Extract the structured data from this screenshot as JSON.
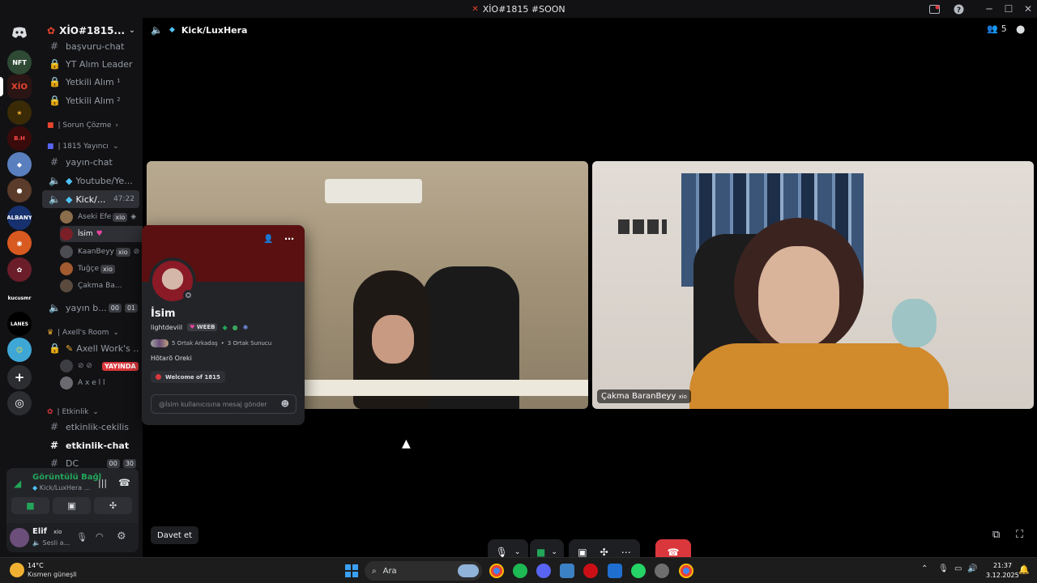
{
  "window": {
    "title": "XİO#1815 #SOON"
  },
  "server": {
    "name": "XİO#1815..."
  },
  "channels": {
    "items": [
      {
        "label": "başvuru-chat",
        "icon": "hash-icon"
      },
      {
        "label": "YT Alım Leader",
        "icon": "lock-icon"
      },
      {
        "label": "Yetkili Alım ¹",
        "icon": "lock-icon"
      },
      {
        "label": "Yetkili Alım ²",
        "icon": "lock-icon"
      }
    ],
    "cat_sorun": "| Sorun Çözme",
    "cat_yayinci": "| 1815 Yayıncı",
    "yayin_chat": "yayın-chat",
    "youtube": "Youtube/Ye...",
    "kick": "Kick/...",
    "kick_time": "47:22",
    "voice_users": [
      {
        "name": "Aseki Efe",
        "tag": "xio"
      },
      {
        "name": "İsim",
        "tag": ""
      },
      {
        "name": "KaanBeyy",
        "tag": "xio"
      },
      {
        "name": "Tuğçe",
        "tag": "xio"
      },
      {
        "name": "Çakma Ba...",
        "tag": ""
      }
    ],
    "yayin_b": "yayın b...",
    "yayin_b_counts": [
      "00",
      "01"
    ],
    "cat_axell": "| Axell's Room",
    "axell_work": "Axell Work's ...",
    "live_badge": "YAYINDA",
    "axell_user": "A x e l l",
    "cat_etkinlik": "| Etkinlik",
    "etkinlik_cekilis": "etkinlik-cekilis",
    "etkinlik_chat": "etkinlik-chat",
    "dc": "DC",
    "dc_counts": [
      "00",
      "30"
    ]
  },
  "voice_status": {
    "title": "Görüntülü Bağl",
    "subtitle": "Kick/LuxHera ..."
  },
  "user": {
    "name": "Elif",
    "tag": "xio",
    "status": "Sesli a..."
  },
  "stage": {
    "channel": "Kick/LuxHera",
    "participants": "5",
    "tile2_name": "Çakma BaranBeyy",
    "tile2_tag": "xio"
  },
  "profile": {
    "display_name": "İsim",
    "username": "lightdeviil",
    "tag": "WEEB",
    "mutual_friends": "5 Ortak Arkadaş",
    "mutual_servers": "3 Ortak Sunucu",
    "bio": "Hōtarō Oreki",
    "role": "Welcome of 1815",
    "message_placeholder": "@İsim kullanıcısına mesaj gönder"
  },
  "invite": "Davet et",
  "taskbar": {
    "weather_temp": "14°C",
    "weather_desc": "Kısmen güneşli",
    "search": "Ara",
    "time": "21:37",
    "date": "3.12.2025"
  },
  "colors": {
    "accent": "#5865f2",
    "green": "#23a55a",
    "red": "#da373c",
    "live": "#da373c"
  }
}
